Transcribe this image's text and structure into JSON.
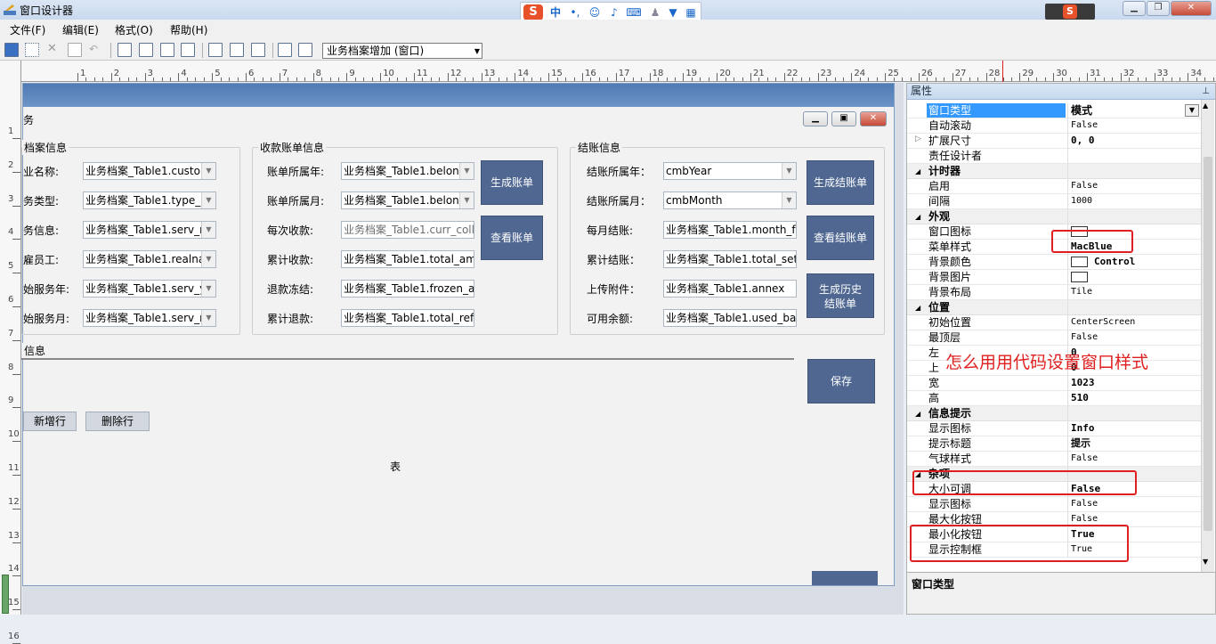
{
  "window": {
    "title": "窗口设计器"
  },
  "ime": {
    "mode": "中",
    "punct": "•,"
  },
  "menu": [
    "文件(F)",
    "编辑(E)",
    "格式(O)",
    "帮助(H)"
  ],
  "toolbar": {
    "combo_value": "业务档案增加 (窗口)"
  },
  "ruler": {
    "top_numbers": [
      "1",
      "2",
      "3",
      "4",
      "5",
      "6",
      "7",
      "8",
      "9",
      "10",
      "11",
      "12",
      "13",
      "14",
      "15",
      "16",
      "17",
      "18",
      "19",
      "20",
      "21",
      "22",
      "23",
      "24",
      "25",
      "26",
      "27",
      "28",
      "29",
      "30",
      "31",
      "32",
      "33",
      "34"
    ],
    "left_numbers": [
      "1",
      "2",
      "3",
      "4",
      "5",
      "6",
      "7",
      "8",
      "9",
      "10",
      "11",
      "12",
      "13",
      "14",
      "15",
      "16"
    ]
  },
  "form": {
    "title": "务",
    "group1": {
      "title": "档案信息",
      "labels": [
        "业名称:",
        "务类型:",
        "务信息:",
        "雇员工:",
        "始服务年:",
        "始服务月:"
      ],
      "values": [
        "业务档案_Table1.custor",
        "业务档案_Table1.type_r",
        "业务档案_Table1.serv_r",
        "业务档案_Table1.realna",
        "业务档案_Table1.serv_y",
        "业务档案_Table1.serv_r"
      ]
    },
    "group2": {
      "title": "收款账单信息",
      "labels": [
        "账单所属年:",
        "账单所属月:",
        "每次收款:",
        "累计收款:",
        "退款冻结:",
        "累计退款:"
      ],
      "values": [
        "业务档案_Table1.belon",
        "业务档案_Table1.belon",
        "业务档案_Table1.curr_coll",
        "业务档案_Table1.total_amc",
        "业务档案_Table1.frozen_ar",
        "业务档案_Table1.total_refu"
      ],
      "btn_generate": "生成账单",
      "btn_view": "查看账单"
    },
    "group3": {
      "title": "结账信息",
      "labels": [
        "结账所属年：",
        "结账所属月：",
        "每月结账:",
        "累计结账：",
        "上传附件：",
        "可用余额:"
      ],
      "values": [
        "cmbYear",
        "cmbMonth",
        "业务档案_Table1.month_fe",
        "业务档案_Table1.total_setti",
        "业务档案_Table1.annex",
        "业务档案_Table1.used_bal"
      ],
      "btn_generate": "生成结账单",
      "btn_view": "查看结账单",
      "btn_history": [
        "生成历史",
        "结账单"
      ]
    },
    "detail": {
      "title": "信息",
      "btn_add": "新增行",
      "btn_delete": "删除行",
      "table_label": "表",
      "btn_save": "保存"
    }
  },
  "properties": {
    "header": "属性",
    "rows": [
      {
        "kind": "prop",
        "name": "窗口类型",
        "value": "模式",
        "bold": true,
        "selected": true
      },
      {
        "kind": "prop",
        "name": "自动滚动",
        "value": "False"
      },
      {
        "kind": "prop",
        "name": "扩展尺寸",
        "value": "0, 0",
        "bold": true
      },
      {
        "kind": "prop",
        "name": "责任设计者",
        "value": ""
      },
      {
        "kind": "cat",
        "name": "计时器"
      },
      {
        "kind": "prop",
        "name": "启用",
        "value": "False"
      },
      {
        "kind": "prop",
        "name": "间隔",
        "value": "1000"
      },
      {
        "kind": "cat",
        "name": "外观"
      },
      {
        "kind": "prop",
        "name": "窗口图标",
        "value": ""
      },
      {
        "kind": "prop",
        "name": "菜单样式",
        "value": "MacBlue",
        "bold": true
      },
      {
        "kind": "prop",
        "name": "背景颜色",
        "value": "Control",
        "bold": true
      },
      {
        "kind": "prop",
        "name": "背景图片",
        "value": ""
      },
      {
        "kind": "prop",
        "name": "背景布局",
        "value": "Tile"
      },
      {
        "kind": "cat",
        "name": "位置"
      },
      {
        "kind": "prop",
        "name": "初始位置",
        "value": "CenterScreen"
      },
      {
        "kind": "prop",
        "name": "最顶层",
        "value": "False"
      },
      {
        "kind": "prop",
        "name": "左",
        "value": "0",
        "bold": true
      },
      {
        "kind": "prop",
        "name": "上",
        "value": "0",
        "bold": true
      },
      {
        "kind": "prop",
        "name": "宽",
        "value": "1023",
        "bold": true
      },
      {
        "kind": "prop",
        "name": "高",
        "value": "510",
        "bold": true
      },
      {
        "kind": "cat",
        "name": "信息提示"
      },
      {
        "kind": "prop",
        "name": "显示图标",
        "value": "Info",
        "bold": true
      },
      {
        "kind": "prop",
        "name": "提示标题",
        "value": "提示",
        "bold": true
      },
      {
        "kind": "prop",
        "name": "气球样式",
        "value": "False"
      },
      {
        "kind": "cat",
        "name": "杂项"
      },
      {
        "kind": "prop",
        "name": "大小可调",
        "value": "False",
        "bold": true
      },
      {
        "kind": "prop",
        "name": "显示图标",
        "value": "False"
      },
      {
        "kind": "prop",
        "name": "最大化按钮",
        "value": "False"
      },
      {
        "kind": "prop",
        "name": "最小化按钮",
        "value": "True",
        "bold": true
      },
      {
        "kind": "prop",
        "name": "显示控制框",
        "value": "True"
      }
    ],
    "description_title": "窗口类型"
  },
  "annotation": "怎么用用代码设置窗口样式",
  "colors": {
    "accent_button": "#4f6791",
    "annotation": "#e02020",
    "selected_row": "#3399ff"
  }
}
